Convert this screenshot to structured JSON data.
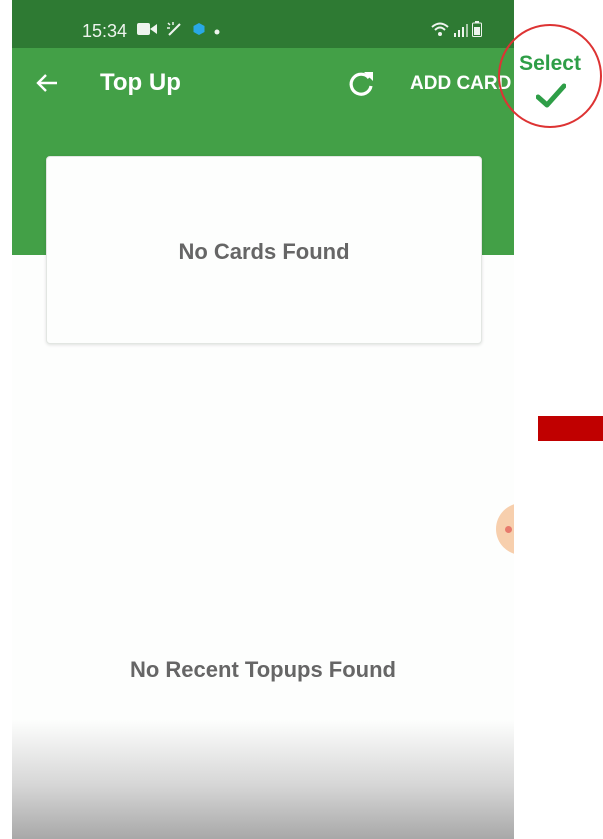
{
  "status_bar": {
    "time": "15:34",
    "icons": [
      "video-icon",
      "magic-wand-icon",
      "app-notification-icon",
      "dot-icon",
      "wifi-icon",
      "signal-icon",
      "battery-icon"
    ]
  },
  "app_bar": {
    "title": "Top Up",
    "add_card_label": "ADD CARD",
    "back_icon": "arrow-left-icon",
    "refresh_icon": "refresh-icon"
  },
  "cards_section": {
    "empty_text": "No Cards Found"
  },
  "topups_section": {
    "empty_text": "No Recent Topups Found"
  },
  "overlay": {
    "select_label": "Select",
    "check_icon": "check-icon"
  },
  "colors": {
    "status_bar": "#2e7a33",
    "primary": "#43a047",
    "empty_text": "#666666",
    "select_green": "#2e9e47",
    "circle_red": "#dd3333",
    "bar_red": "#c00000"
  }
}
